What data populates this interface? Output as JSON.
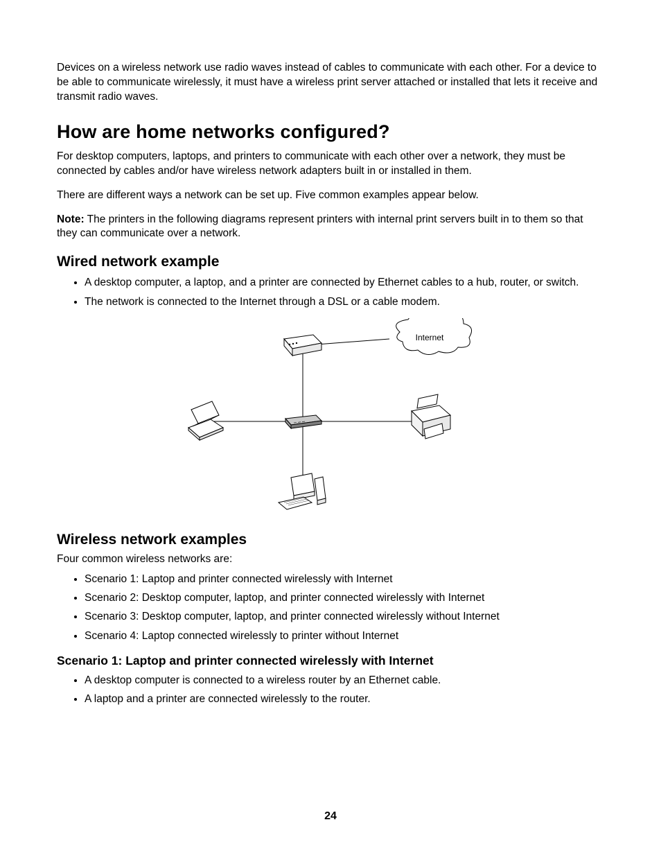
{
  "intro_paragraph": "Devices on a wireless network use radio waves instead of cables to communicate with each other. For a device to be able to communicate wirelessly, it must have a wireless print server attached or installed that lets it receive and transmit radio waves.",
  "heading_main": "How are home networks configured?",
  "para1": "For desktop computers, laptops, and printers to communicate with each other over a network, they must be connected by cables and/or have wireless network adapters built in or installed in them.",
  "para2": "There are different ways a network can be set up. Five common examples appear below.",
  "note_label": "Note:",
  "note_text": " The printers in the following diagrams represent printers with internal print servers built in to them so that they can communicate over a network.",
  "wired_heading": "Wired network example",
  "wired_bullets": [
    "A desktop computer, a laptop, and a printer are connected by Ethernet cables to a hub, router, or switch.",
    "The network is connected to the Internet through a DSL or a cable modem."
  ],
  "diagram_label_internet": "Internet",
  "wireless_heading": "Wireless network examples",
  "wireless_intro": "Four common wireless networks are:",
  "wireless_bullets": [
    "Scenario 1: Laptop and printer connected wirelessly with Internet",
    "Scenario 2: Desktop computer, laptop, and printer connected wirelessly with Internet",
    "Scenario 3: Desktop computer, laptop, and printer connected wirelessly without Internet",
    "Scenario 4: Laptop connected wirelessly to printer without Internet"
  ],
  "scenario1_heading": "Scenario 1: Laptop and printer connected wirelessly with Internet",
  "scenario1_bullets": [
    "A desktop computer is connected to a wireless router by an Ethernet cable.",
    "A laptop and a printer are connected wirelessly to the router."
  ],
  "page_number": "24"
}
